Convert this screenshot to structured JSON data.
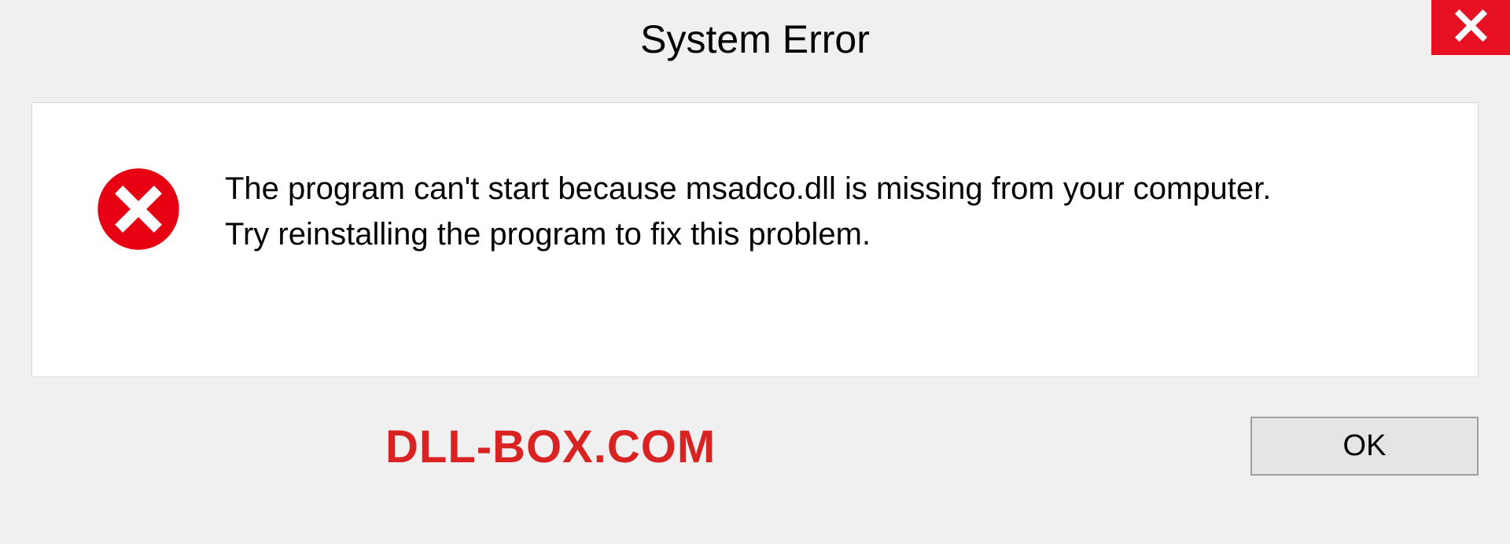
{
  "titlebar": {
    "title": "System Error"
  },
  "message": {
    "line1": "The program can't start because msadco.dll is missing from your computer.",
    "line2": "Try reinstalling the program to fix this problem."
  },
  "footer": {
    "watermark": "DLL-BOX.COM",
    "ok_label": "OK"
  },
  "colors": {
    "close_bg": "#e81123",
    "error_icon": "#e60012",
    "watermark": "#d92323"
  }
}
